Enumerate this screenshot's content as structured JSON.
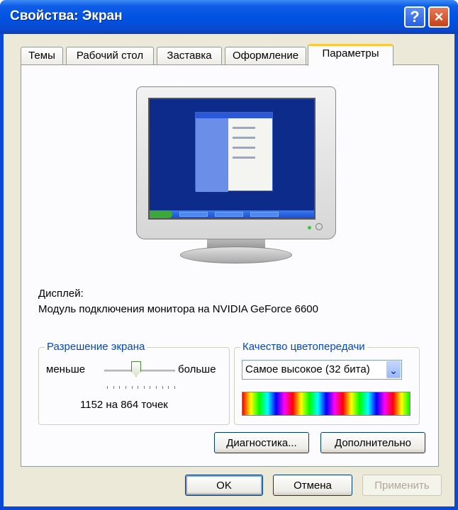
{
  "window": {
    "title": "Свойства: Экран",
    "help_glyph": "?",
    "close_glyph": "×"
  },
  "tabs": [
    {
      "label": "Темы"
    },
    {
      "label": "Рабочий стол"
    },
    {
      "label": "Заставка"
    },
    {
      "label": "Оформление"
    },
    {
      "label": "Параметры",
      "active": true
    }
  ],
  "display": {
    "caption": "Дисплей:",
    "device": "Модуль подключения монитора на NVIDIA GeForce 6600"
  },
  "resolution": {
    "legend": "Разрешение экрана",
    "less_label": "меньше",
    "more_label": "больше",
    "value_text": "1152 на 864 точек",
    "slider_position_fraction": 0.45
  },
  "color_quality": {
    "legend": "Качество цветопередачи",
    "selected": "Самое высокое (32 бита)"
  },
  "buttons": {
    "diagnostics": "Диагностика...",
    "advanced": "Дополнительно",
    "ok": "OK",
    "cancel": "Отмена",
    "apply": "Применить"
  },
  "colors": {
    "titlebar": "#0052e2",
    "dialog_bg": "#ece9d8",
    "tab_active_accent": "#ffc83c",
    "legend_text": "#0046d5",
    "close_button": "#c8401a"
  },
  "icons": [
    "help-icon",
    "close-icon",
    "dropdown-arrow-icon",
    "monitor-preview",
    "slider-thumb"
  ]
}
